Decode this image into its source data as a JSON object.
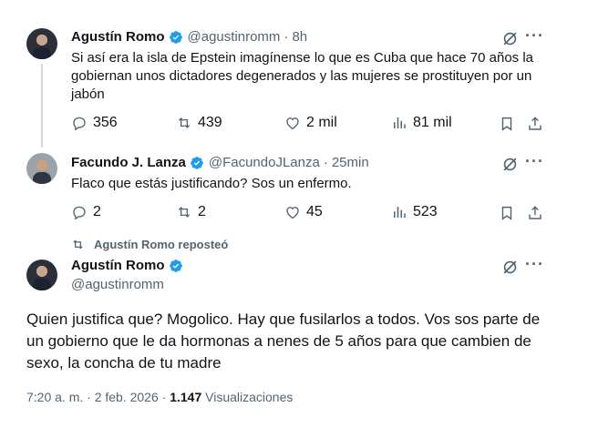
{
  "tweet1": {
    "name": "Agustín Romo",
    "handle": "@agustinromm",
    "sep": "·",
    "time": "8h",
    "text": "Si así era la isla de Epstein imagínense lo que es Cuba que hace 70 años la gobiernan unos dictadores degenerados y las mujeres se prostituyen por un jabón",
    "replies": "356",
    "reposts": "439",
    "likes": "2 mil",
    "views": "81 mil",
    "more": "···"
  },
  "tweet2": {
    "name": "Facundo J. Lanza",
    "handle": "@FacundoJLanza",
    "sep": "·",
    "time": "25min",
    "text": "Flaco que estás justificando? Sos un enfermo.",
    "replies": "2",
    "reposts": "2",
    "likes": "45",
    "views": "523",
    "more": "···"
  },
  "repost_bar": {
    "label": "Agustín Romo reposteó"
  },
  "tweet3": {
    "name": "Agustín Romo",
    "handle": "@agustinromm",
    "text": "Quien justifica que? Mogolico. Hay que fusilarlos a todos. Vos sos parte de un gobierno que le da hormonas a nenes de 5 años para que cambien de sexo, la concha de tu madre",
    "timestamp": "7:20 a. m. · 2 feb. 2026 ·",
    "views_count": "1.147",
    "views_label": "Visualizaciones",
    "more": "···"
  },
  "colors": {
    "verified": "#1d9bf0",
    "secondary": "#536471",
    "text": "#0f1419",
    "line": "#cfd9de"
  },
  "icons": [
    "reply-icon",
    "repost-icon",
    "like-icon",
    "views-icon",
    "bookmark-icon",
    "share-icon",
    "grok-icon",
    "more-icon",
    "verified-badge-icon"
  ]
}
